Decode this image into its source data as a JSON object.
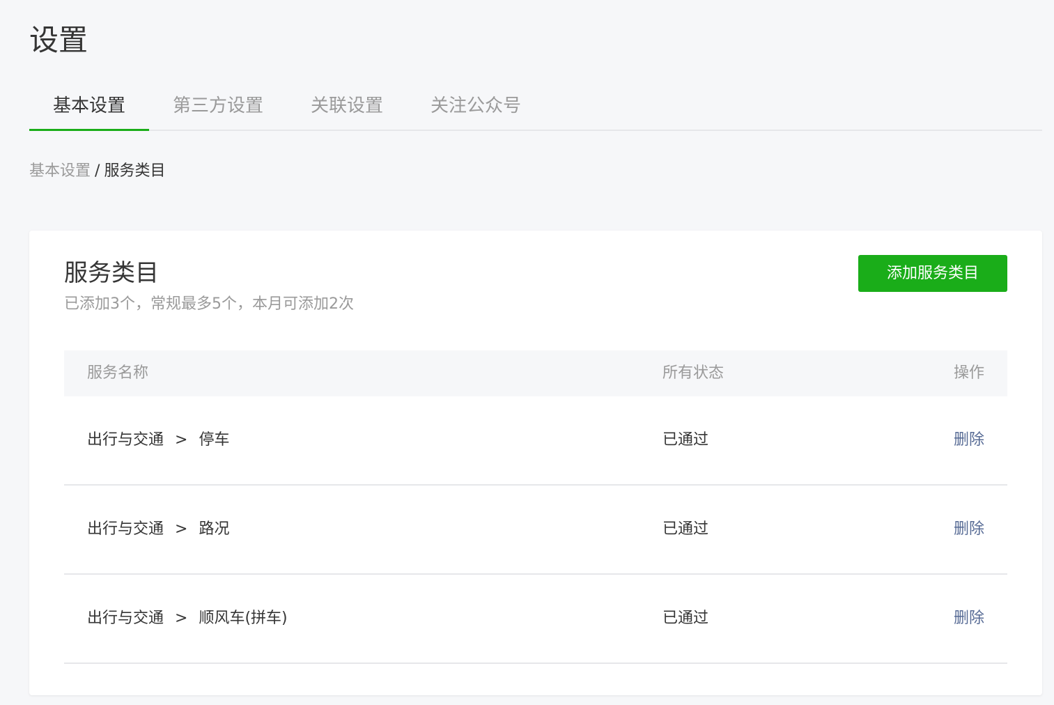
{
  "page": {
    "title": "设置"
  },
  "tabs": [
    {
      "label": "基本设置",
      "active": true
    },
    {
      "label": "第三方设置",
      "active": false
    },
    {
      "label": "关联设置",
      "active": false
    },
    {
      "label": "关注公众号",
      "active": false
    }
  ],
  "breadcrumb": {
    "parent": "基本设置",
    "separator": "/",
    "current": "服务类目"
  },
  "card": {
    "title": "服务类目",
    "description": "已添加3个，常规最多5个，本月可添加2次",
    "add_button": "添加服务类目"
  },
  "table": {
    "headers": {
      "name": "服务名称",
      "status": "所有状态",
      "operation": "操作"
    },
    "rows": [
      {
        "category": "出行与交通",
        "arrow": ">",
        "subcategory": "停车",
        "status": "已通过",
        "action": "删除"
      },
      {
        "category": "出行与交通",
        "arrow": ">",
        "subcategory": "路况",
        "status": "已通过",
        "action": "删除"
      },
      {
        "category": "出行与交通",
        "arrow": ">",
        "subcategory": "顺风车(拼车)",
        "status": "已通过",
        "action": "删除"
      }
    ]
  },
  "colors": {
    "accent": "#1aad19",
    "link": "#576b95",
    "text_primary": "#353535",
    "text_secondary": "#9a9a9a",
    "background": "#f6f7f9"
  }
}
